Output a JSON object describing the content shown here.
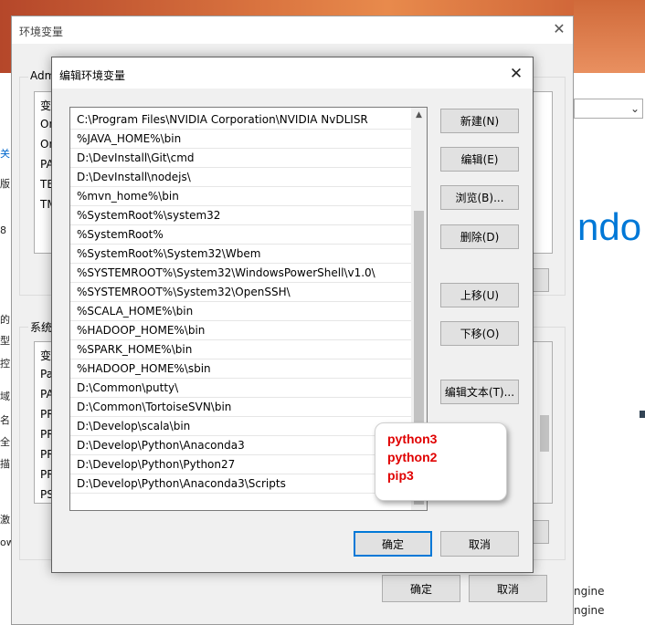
{
  "background": {
    "right_logo_text": "ndo",
    "right_lines": [
      "ngine",
      "ngine"
    ],
    "left_glyphs": [
      "关",
      "版",
      "8",
      "的",
      "型",
      "控",
      "域",
      "名",
      "全",
      "描",
      "激",
      "ow"
    ]
  },
  "outer_dialog": {
    "title": "环境变量",
    "close_icon": "✕",
    "user_group_label": "Adm",
    "user_vars": [
      "变",
      "On",
      "On",
      "PA",
      "TE",
      "TM"
    ],
    "system_group_label": "系统",
    "system_vars": [
      "变",
      "Pa",
      "PA",
      "PR",
      "PR",
      "PR",
      "PR",
      "PS"
    ],
    "ok_label": "确定",
    "cancel_label": "取消"
  },
  "edit_dialog": {
    "title": "编辑环境变量",
    "close_icon": "✕",
    "paths": [
      "C:\\Program Files\\NVIDIA Corporation\\NVIDIA NvDLISR",
      "%JAVA_HOME%\\bin",
      "D:\\DevInstall\\Git\\cmd",
      "D:\\DevInstall\\nodejs\\",
      "%mvn_home%\\bin",
      "%SystemRoot%\\system32",
      "%SystemRoot%",
      "%SystemRoot%\\System32\\Wbem",
      "%SYSTEMROOT%\\System32\\WindowsPowerShell\\v1.0\\",
      "%SYSTEMROOT%\\System32\\OpenSSH\\",
      "%SCALA_HOME%\\bin",
      "%HADOOP_HOME%\\bin",
      "%SPARK_HOME%\\bin",
      "%HADOOP_HOME%\\sbin",
      "D:\\Common\\putty\\",
      "D:\\Common\\TortoiseSVN\\bin",
      "D:\\Develop\\scala\\bin",
      "D:\\Develop\\Python\\Anaconda3",
      "D:\\Develop\\Python\\Python27",
      "D:\\Develop\\Python\\Anaconda3\\Scripts",
      ""
    ],
    "buttons": {
      "new": "新建(N)",
      "edit": "编辑(E)",
      "browse": "浏览(B)...",
      "delete": "删除(D)",
      "move_up": "上移(U)",
      "move_down": "下移(O)",
      "edit_text": "编辑文本(T)...",
      "ok": "确定",
      "cancel": "取消"
    },
    "scroll_up_icon": "▲"
  },
  "annotation": {
    "lines": [
      "python3",
      "python2",
      "pip3"
    ],
    "color": "#e00000"
  }
}
